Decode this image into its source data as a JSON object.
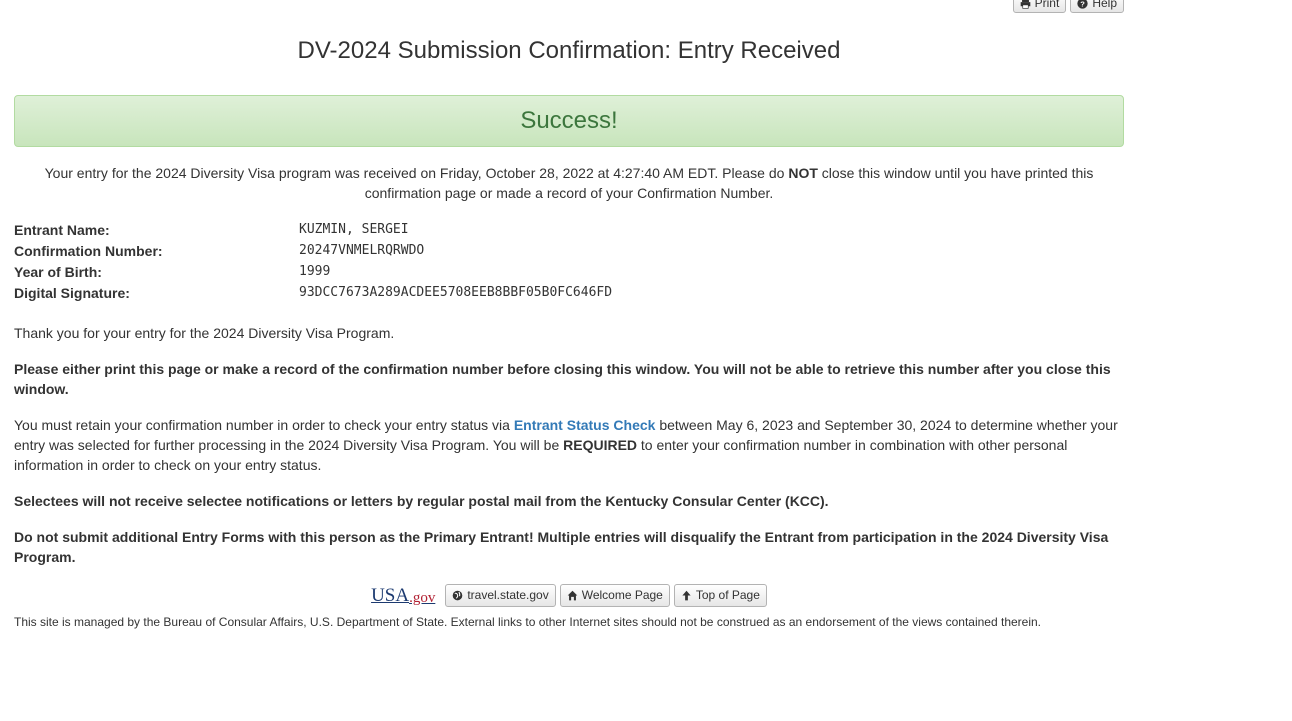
{
  "header": {
    "print_label": "Print",
    "help_label": "Help",
    "title": "DV-2024 Submission Confirmation: Entry Received"
  },
  "success": {
    "label": "Success!"
  },
  "received": {
    "part1": "Your entry for the 2024 Diversity Visa program was received on Friday, October 28, 2022 at 4:27:40 AM EDT. Please do ",
    "emphasis": "NOT",
    "part2": " close this window until you have printed this confirmation page or made a record of your Confirmation Number."
  },
  "entrant": {
    "name_label": "Entrant Name:",
    "name_value": "KUZMIN, SERGEI",
    "confirmation_label": "Confirmation Number:",
    "confirmation_value": "20247VNMELRQRWDO",
    "birth_label": "Year of Birth:",
    "birth_value": "1999",
    "signature_label": "Digital Signature:",
    "signature_value": "93DCC7673A289ACDEE5708EEB8BBF05B0FC646FD"
  },
  "body": {
    "thanks": "Thank you for your entry for the 2024 Diversity Visa Program.",
    "print_warning": "Please either print this page or make a record of the confirmation number before closing this window. You will not be able to retrieve this number after you close this window.",
    "retain_part1": "You must retain your confirmation number in order to check your entry status via ",
    "retain_link": "Entrant Status Check",
    "retain_part2": " between May 6, 2023 and September 30, 2024 to determine whether your entry was selected for further processing in the 2024 Diversity Visa Program. You will be ",
    "retain_emphasis": "REQUIRED",
    "retain_part3": " to enter your confirmation number in combination with other personal information in order to check on your entry status.",
    "selectees": "Selectees will not receive selectee notifications or letters by regular postal mail from the Kentucky Consular Center (KCC).",
    "no_additional": "Do not submit additional Entry Forms with this person as the Primary Entrant! Multiple entries will disqualify the Entrant from participation in the 2024 Diversity Visa Program."
  },
  "footer": {
    "usa_logo_text": "USA",
    "usa_logo_gov": ".gov",
    "travel_label": "travel.state.gov",
    "welcome_label": "Welcome Page",
    "top_label": "Top of Page",
    "disclaimer": "This site is managed by the Bureau of Consular Affairs, U.S. Department of State. External links to other Internet sites should not be construed as an endorsement of the views contained therein."
  },
  "colors": {
    "success_text": "#3c763d",
    "success_bg": "#dff0d8",
    "link": "#337ab7"
  }
}
